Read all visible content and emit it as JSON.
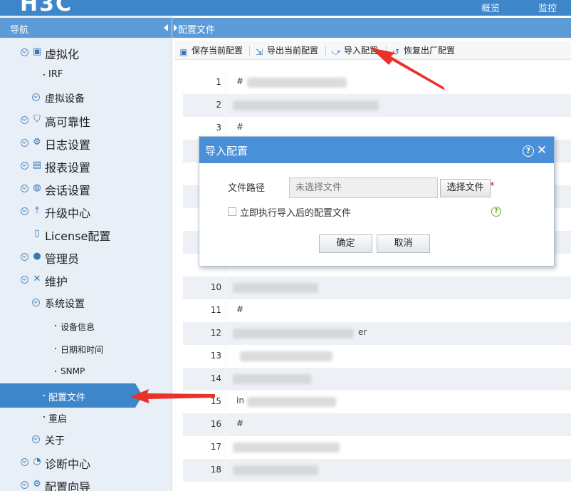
{
  "header": {
    "logo": "H3C",
    "links": [
      "概览",
      "监控"
    ]
  },
  "sidebar": {
    "title": "导航",
    "items": [
      {
        "label": "虚拟化",
        "icon": "virtualization-icon",
        "level": 0
      },
      {
        "label": "IRF",
        "level": 2
      },
      {
        "label": "虚拟设备",
        "level": 1
      },
      {
        "label": "高可靠性",
        "icon": "shield-icon",
        "level": 0
      },
      {
        "label": "日志设置",
        "icon": "log-icon",
        "level": 0
      },
      {
        "label": "报表设置",
        "icon": "report-icon",
        "level": 0
      },
      {
        "label": "会话设置",
        "icon": "chat-icon",
        "level": 0
      },
      {
        "label": "升级中心",
        "icon": "upload-icon",
        "level": 0
      },
      {
        "label": "License配置",
        "icon": "license-icon",
        "level": 0
      },
      {
        "label": "管理员",
        "icon": "users-icon",
        "level": 0
      },
      {
        "label": "维护",
        "icon": "tools-icon",
        "level": 0
      },
      {
        "label": "系统设置",
        "level": 1
      },
      {
        "label": "设备信息",
        "level": 3
      },
      {
        "label": "日期和时间",
        "level": 3
      },
      {
        "label": "SNMP",
        "level": 3
      },
      {
        "label": "配置文件",
        "level": 2,
        "active": true
      },
      {
        "label": "重启",
        "level": 2
      },
      {
        "label": "关于",
        "level": 1
      },
      {
        "label": "诊断中心",
        "icon": "diagnose-icon",
        "level": 0
      },
      {
        "label": "配置向导",
        "icon": "wizard-icon",
        "level": 0
      }
    ]
  },
  "main": {
    "breadcrumb": "配置文件",
    "toolbar": {
      "save": "保存当前配置",
      "export": "导出当前配置",
      "import": "导入配置",
      "restore": "恢复出厂配置"
    },
    "config_lines": [
      {
        "n": "1",
        "text": "#"
      },
      {
        "n": "2",
        "text": ""
      },
      {
        "n": "3",
        "text": "#"
      },
      {
        "n": "10",
        "text": ""
      },
      {
        "n": "11",
        "text": "#"
      },
      {
        "n": "12",
        "text": "er"
      },
      {
        "n": "13",
        "text": ""
      },
      {
        "n": "14",
        "text": ""
      },
      {
        "n": "15",
        "text": "in"
      },
      {
        "n": "16",
        "text": "#"
      },
      {
        "n": "17",
        "text": ""
      },
      {
        "n": "18",
        "text": ""
      }
    ]
  },
  "dialog": {
    "title": "导入配置",
    "file_path_label": "文件路径",
    "file_path_placeholder": "未选择文件",
    "choose_file": "选择文件",
    "required_mark": "*",
    "apply_checkbox_label": "立即执行导入后的配置文件",
    "ok": "确定",
    "cancel": "取消"
  },
  "colors": {
    "brand_blue": "#3d86c9",
    "header_blue": "#5c9bd6",
    "annotation_red": "#e8322a"
  }
}
